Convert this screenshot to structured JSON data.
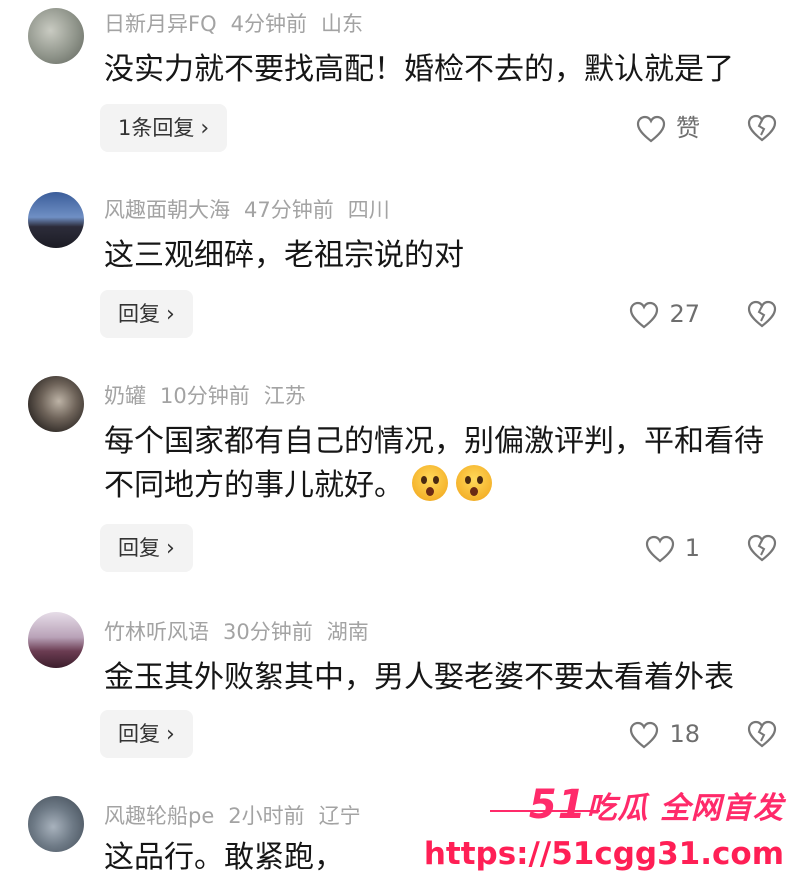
{
  "comments": [
    {
      "username": "日新月异FQ",
      "time": "4分钟前",
      "location": "山东",
      "text": "没实力就不要找高配！婚检不去的，默认就是了",
      "reply_label": "1条回复",
      "like_label": "赞"
    },
    {
      "username": "风趣面朝大海",
      "time": "47分钟前",
      "location": "四川",
      "text": "这三观细碎，老祖宗说的对",
      "reply_label": "回复",
      "like_label": "27"
    },
    {
      "username": "奶罐",
      "time": "10分钟前",
      "location": "江苏",
      "text": "每个国家都有自己的情况，别偏激评判，平和看待不同地方的事儿就好。",
      "reply_label": "回复",
      "like_label": "1"
    },
    {
      "username": "竹林听风语",
      "time": "30分钟前",
      "location": "湖南",
      "text": "金玉其外败絮其中，男人娶老婆不要太看着外表",
      "reply_label": "回复",
      "like_label": "18"
    },
    {
      "username": "风趣轮船pe",
      "time": "2小时前",
      "location": "辽宁",
      "text": "这品行。敢紧跑，"
    }
  ],
  "chevron": "›",
  "watermark": {
    "number": "51",
    "brand": "吃瓜 全网首发",
    "url": "https://51cgg31.com"
  },
  "icons": {
    "like": "heart-icon",
    "dislike": "broken-heart-icon",
    "emoji": "surprised-face-emoji"
  },
  "colors": {
    "meta": "#a3a3a3",
    "watermark": "#ff2a6a"
  }
}
